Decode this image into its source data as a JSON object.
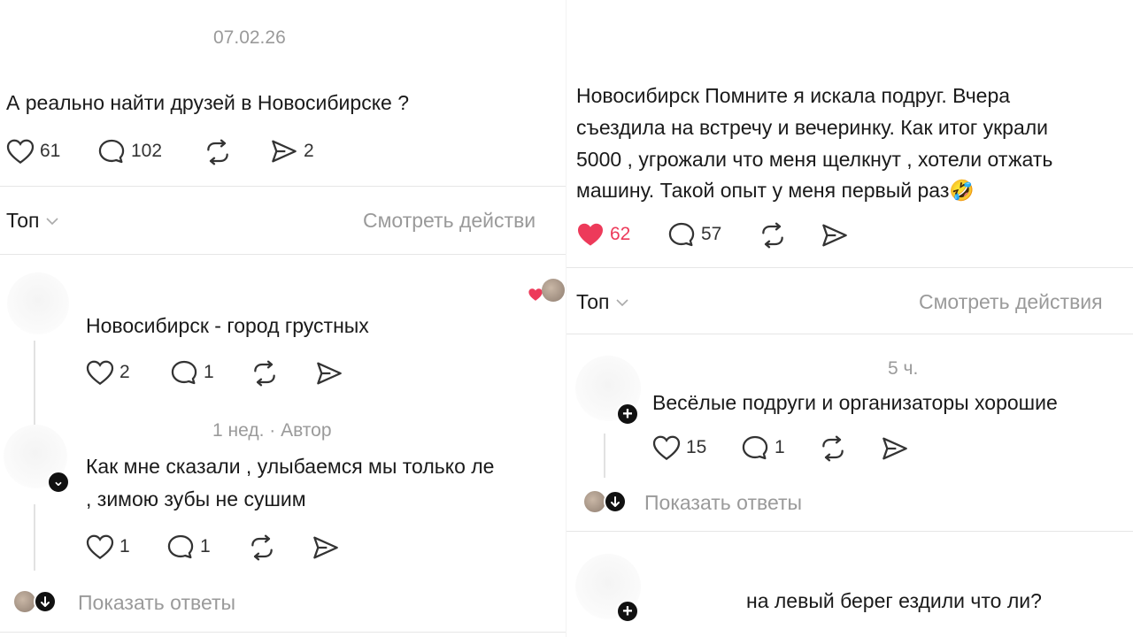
{
  "left": {
    "date": "07.02.26",
    "post_text": "А реально найти друзей в Новосибирске ?",
    "post_stats": {
      "likes": "61",
      "comments": "102",
      "shares": "2"
    },
    "sort_label": "Топ",
    "activity_link": "Смотреть действи",
    "reply1": {
      "text": "Новосибирск - город грустных",
      "likes": "2",
      "comments": "1"
    },
    "reply2": {
      "meta": "1 нед. · Автор",
      "text_line1": "Как мне сказали , улыбаемся мы только ле",
      "text_line2": ", зимою зубы не сушим",
      "likes": "1",
      "comments": "1"
    },
    "show_replies": "Показать ответы"
  },
  "right": {
    "post_text_lines": [
      "Новосибирск Помните я искала подруг. Вчера",
      "съездила на встречу и вечеринку. Как итог украли",
      "5000 , угрожали что меня щелкнут , хотели отжать",
      "машину. Такой опыт у меня первый раз"
    ],
    "post_emoji": "🤣",
    "post_stats": {
      "likes": "62",
      "comments": "57"
    },
    "sort_label": "Топ",
    "activity_link": "Смотреть действия",
    "reply1": {
      "time": "5 ч.",
      "text": "Весёлые подруги и организаторы хорошие",
      "likes": "15",
      "comments": "1"
    },
    "show_replies": "Показать ответы",
    "reply2": {
      "text": "на левый берег ездили что ли?"
    }
  },
  "colors": {
    "like_active": "#ed3a5a",
    "muted_text": "#9a9a9a",
    "divider": "#e6e6e6"
  }
}
